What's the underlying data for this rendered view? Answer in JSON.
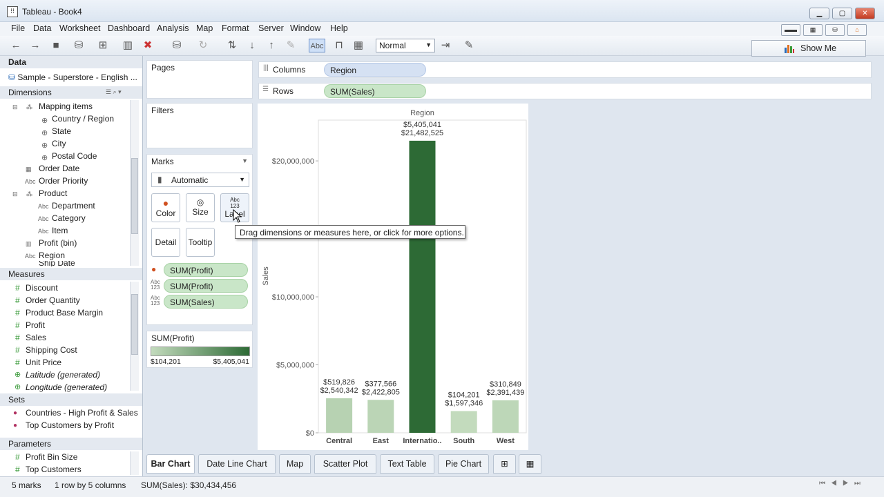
{
  "window": {
    "title": "Tableau - Book4",
    "app_icon": "tableau-icon"
  },
  "menu": [
    "File",
    "Data",
    "Worksheet",
    "Dashboard",
    "Analysis",
    "Map",
    "Format",
    "Server",
    "Window",
    "Help"
  ],
  "toolbar": {
    "fit_select": "Normal",
    "show_me": "Show Me",
    "label_btn": "Abc"
  },
  "data_panel": {
    "header": "Data",
    "source": "Sample - Superstore - English ...",
    "dimensions_header": "Dimensions",
    "dimensions": [
      "Mapping items",
      "Country / Region",
      "State",
      "City",
      "Postal Code",
      "Order Date",
      "Order Priority",
      "Product",
      "Department",
      "Category",
      "Item",
      "Profit (bin)",
      "Region",
      "Ship Date"
    ],
    "measures_header": "Measures",
    "measures": [
      "Discount",
      "Order Quantity",
      "Product Base Margin",
      "Profit",
      "Sales",
      "Shipping Cost",
      "Unit Price",
      "Latitude (generated)",
      "Longitude (generated)"
    ],
    "sets_header": "Sets",
    "sets": [
      "Countries - High Profit & Sales",
      "Top Customers by Profit"
    ],
    "params_header": "Parameters",
    "params": [
      "Profit Bin Size",
      "Top Customers"
    ]
  },
  "cards": {
    "pages": "Pages",
    "filters": "Filters",
    "marks": "Marks",
    "mark_type": "Automatic",
    "buttons": [
      "Color",
      "Size",
      "Label",
      "Detail",
      "Tooltip"
    ],
    "mark_pills": [
      "SUM(Profit)",
      "SUM(Profit)",
      "SUM(Sales)"
    ],
    "legend_title": "SUM(Profit)",
    "legend_min": "$104,201",
    "legend_max": "$5,405,041"
  },
  "shelves": {
    "columns_label": "Columns",
    "columns_pill": "Region",
    "rows_label": "Rows",
    "rows_pill": "SUM(Sales)"
  },
  "tooltip": "Drag dimensions or measures here, or click for more options.",
  "chart_data": {
    "type": "bar",
    "title": "Region",
    "ylabel": "Sales",
    "categories": [
      "Central",
      "East",
      "Internatio..",
      "South",
      "West"
    ],
    "values": [
      2540342,
      2422805,
      21482525,
      1597346,
      2391439
    ],
    "profit": [
      519826,
      377566,
      5405041,
      104201,
      310849
    ],
    "value_labels": [
      "$2,540,342",
      "$2,422,805",
      "$21,482,525",
      "$1,597,346",
      "$2,391,439"
    ],
    "profit_labels": [
      "$519,826",
      "$377,566",
      "$5,405,041",
      "$104,201",
      "$310,849"
    ],
    "yticks": [
      0,
      5000000,
      10000000,
      20000000
    ],
    "ytick_labels": [
      "$0",
      "$5,000,000",
      "$10,000,000",
      "$20,000,000"
    ],
    "ylim": [
      0,
      23000000
    ],
    "color_low": "#c3dbbd",
    "color_high": "#2d6a35"
  },
  "tabs": [
    "Bar Chart",
    "Date Line Chart",
    "Map",
    "Scatter Plot",
    "Text Table",
    "Pie Chart"
  ],
  "status": {
    "marks": "5 marks",
    "dims": "1 row by 5 columns",
    "sum": "SUM(Sales): $30,434,456"
  }
}
